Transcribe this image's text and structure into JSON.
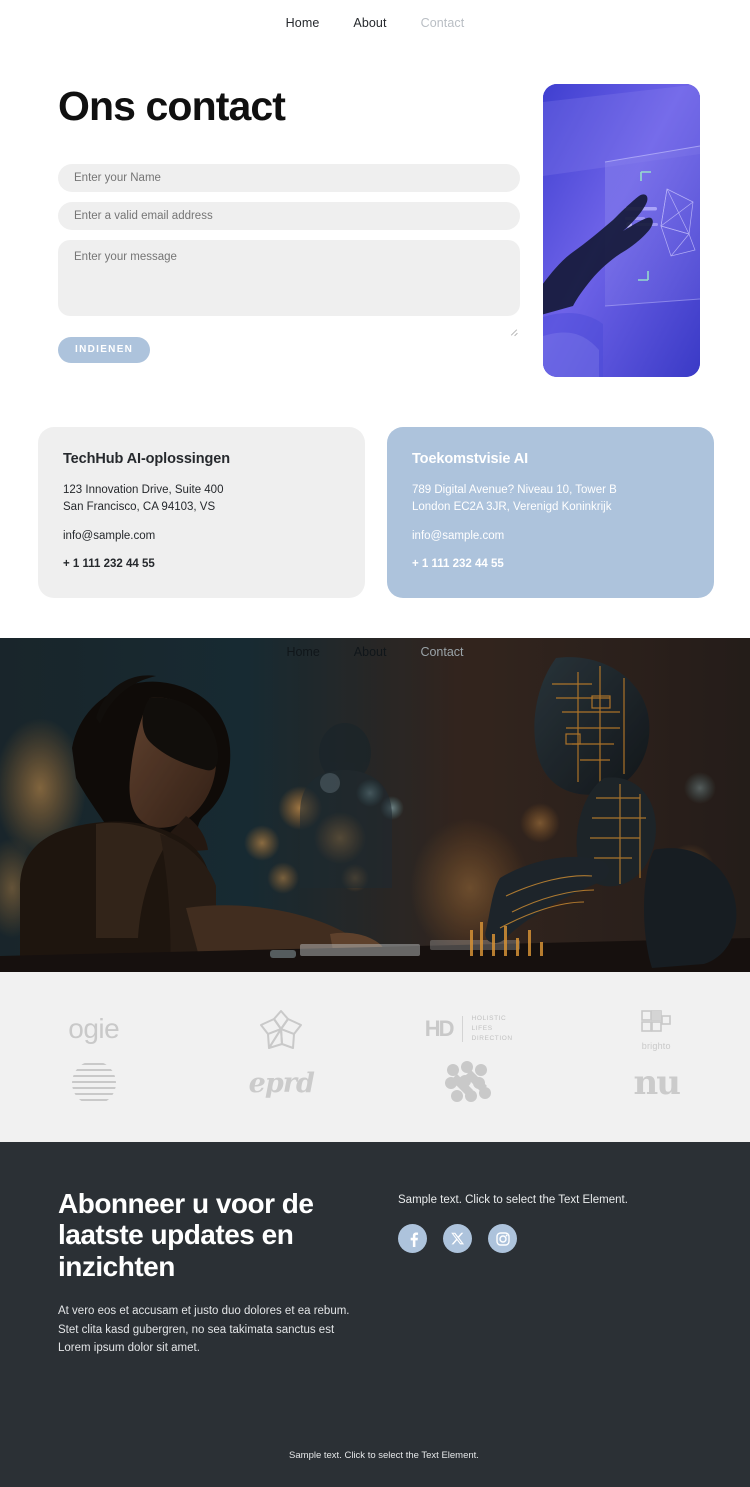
{
  "topnav": {
    "items": [
      {
        "label": "Home",
        "state": "active"
      },
      {
        "label": "About",
        "state": "active"
      },
      {
        "label": "Contact",
        "state": "muted"
      }
    ]
  },
  "contact": {
    "title": "Ons contact",
    "fields": {
      "name_placeholder": "Enter your Name",
      "email_placeholder": "Enter a valid email address",
      "message_placeholder": "Enter your message"
    },
    "submit_label": "INDIENEN",
    "side_image_alt": "hand-touching-holographic-screen"
  },
  "cards": [
    {
      "title": "TechHub AI-oplossingen",
      "address_line1": "123 Innovation Drive, Suite 400",
      "address_line2": "San Francisco, CA 94103, VS",
      "email": "info@sample.com",
      "phone": "+ 1 111 232 44 55"
    },
    {
      "title": "Toekomstvisie AI",
      "address_line1": "789 Digital Avenue? Niveau 10, Tower B",
      "address_line2": "London EC2A 3JR, Verenigd Koninkrijk",
      "email": "info@sample.com",
      "phone": "+ 1 111 232 44 55"
    }
  ],
  "hero": {
    "image_alt": "woman-working-with-ai-robot",
    "nav": [
      {
        "label": "Home",
        "state": "active"
      },
      {
        "label": "About",
        "state": "active"
      },
      {
        "label": "Contact",
        "state": "muted"
      }
    ]
  },
  "logos": {
    "row1": [
      {
        "name": "ogie",
        "type": "wordmark"
      },
      {
        "name": "flower-mark",
        "type": "icon"
      },
      {
        "name": "HD",
        "type": "lockup",
        "tagline": "HOLISTIC\nLIFES\nDIRECTION",
        "tagline_lines": [
          "HOLISTIC",
          "LIFES",
          "DIRECTION"
        ]
      },
      {
        "name": "brighto",
        "type": "icon-word",
        "label": "brighto"
      }
    ],
    "row2": [
      {
        "name": "striped-circle",
        "type": "icon"
      },
      {
        "name": "eprd",
        "type": "script-wordmark"
      },
      {
        "name": "dot-cluster",
        "type": "icon"
      },
      {
        "name": "nu",
        "type": "wordmark"
      }
    ]
  },
  "footer": {
    "title": "Abonneer u voor de laatste updates en inzichten",
    "body_line1": "At vero eos et accusam et justo duo dolores et ea rebum.",
    "body_line2": "Stet clita kasd gubergren, no sea takimata sanctus est",
    "body_line3": "Lorem ipsum dolor sit amet.",
    "sample_text": "Sample text. Click to select the Text Element.",
    "socials": [
      {
        "name": "facebook",
        "glyph": "f"
      },
      {
        "name": "x-twitter",
        "glyph": "X"
      },
      {
        "name": "instagram",
        "glyph": "IG"
      }
    ],
    "bottom_text": "Sample text. Click to select the Text Element."
  },
  "colors": {
    "accent_blue": "#adc3dc",
    "field_gray": "#efefef",
    "logo_band": "#f1f1f1",
    "footer_dark": "#2b3035",
    "text_dark": "#26292d",
    "muted_nav": "#b9bec4"
  }
}
